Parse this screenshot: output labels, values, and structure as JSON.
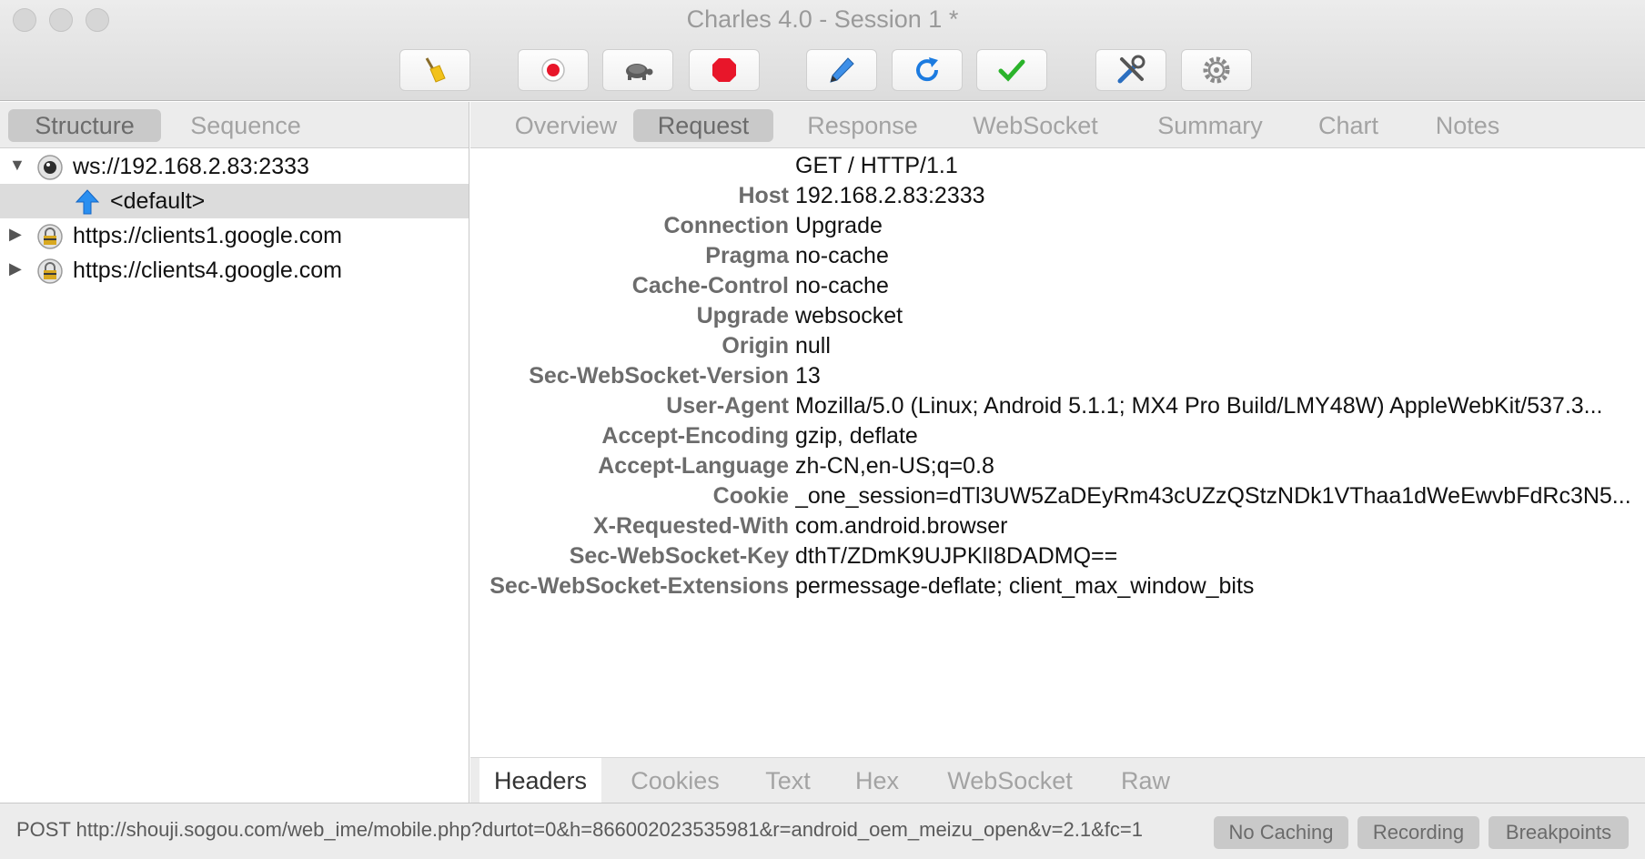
{
  "window": {
    "title": "Charles 4.0 - Session 1 *"
  },
  "toolbar": {
    "buttons": [
      {
        "name": "broom-icon"
      },
      {
        "name": "record-icon"
      },
      {
        "name": "turtle-icon"
      },
      {
        "name": "stop-icon"
      },
      {
        "name": "pen-icon"
      },
      {
        "name": "refresh-icon"
      },
      {
        "name": "checkmark-icon"
      },
      {
        "name": "tools-icon"
      },
      {
        "name": "gear-icon"
      }
    ]
  },
  "left_tabs": [
    "Structure",
    "Sequence"
  ],
  "tree": [
    {
      "label": "ws://192.168.2.83:2333",
      "icon": "websocket-icon",
      "expanded": true
    },
    {
      "label": "<default>",
      "icon": "upload-arrow-icon",
      "selected": true
    },
    {
      "label": "https://clients1.google.com",
      "icon": "lock-icon",
      "expanded": false
    },
    {
      "label": "https://clients4.google.com",
      "icon": "lock-icon",
      "expanded": false
    }
  ],
  "right_tabs": [
    "Overview",
    "Request",
    "Response",
    "WebSocket",
    "Summary",
    "Chart",
    "Notes"
  ],
  "request_line": "GET / HTTP/1.1",
  "headers": [
    {
      "key": "Host",
      "value": "192.168.2.83:2333"
    },
    {
      "key": "Connection",
      "value": "Upgrade"
    },
    {
      "key": "Pragma",
      "value": "no-cache"
    },
    {
      "key": "Cache-Control",
      "value": "no-cache"
    },
    {
      "key": "Upgrade",
      "value": "websocket"
    },
    {
      "key": "Origin",
      "value": "null"
    },
    {
      "key": "Sec-WebSocket-Version",
      "value": "13"
    },
    {
      "key": "User-Agent",
      "value": "Mozilla/5.0 (Linux; Android 5.1.1; MX4 Pro Build/LMY48W) AppleWebKit/537.3..."
    },
    {
      "key": "Accept-Encoding",
      "value": "gzip, deflate"
    },
    {
      "key": "Accept-Language",
      "value": "zh-CN,en-US;q=0.8"
    },
    {
      "key": "Cookie",
      "value": "_one_session=dTl3UW5ZaDEyRm43cUZzQStzNDk1VThaa1dWeEwvbFdRc3N5..."
    },
    {
      "key": "X-Requested-With",
      "value": "com.android.browser"
    },
    {
      "key": "Sec-WebSocket-Key",
      "value": "dthT/ZDmK9UJPKlI8DADMQ=="
    },
    {
      "key": "Sec-WebSocket-Extensions",
      "value": "permessage-deflate; client_max_window_bits"
    }
  ],
  "bottom_tabs": [
    "Headers",
    "Cookies",
    "Text",
    "Hex",
    "WebSocket",
    "Raw"
  ],
  "status": {
    "text": "POST http://shouji.sogou.com/web_ime/mobile.php?durtot=0&h=866002023535981&r=android_oem_meizu_open&v=2.1&fc=1",
    "no_caching": "No Caching",
    "recording": "Recording",
    "breakpoints": "Breakpoints"
  }
}
